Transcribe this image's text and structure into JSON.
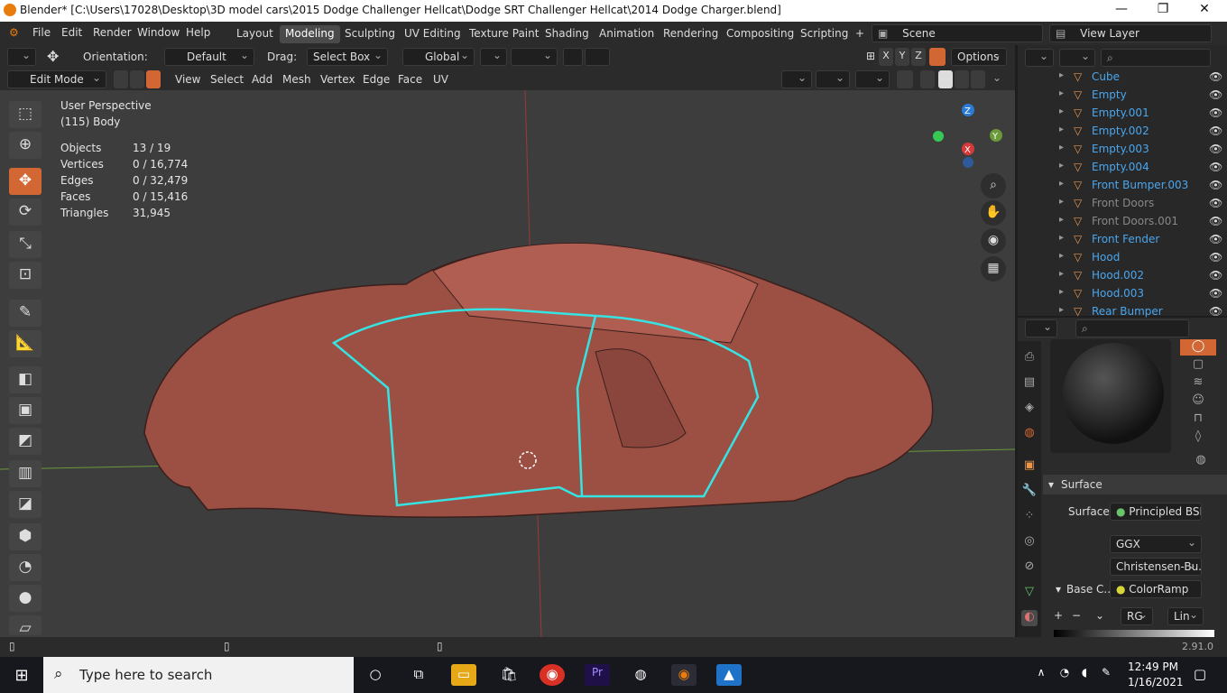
{
  "window": {
    "title": "Blender* [C:\\Users\\17028\\Desktop\\3D model cars\\2015 Dodge Challenger Hellcat\\Dodge SRT Challenger Hellcat\\2014 Dodge Charger.blend]"
  },
  "menus": [
    "File",
    "Edit",
    "Render",
    "Window",
    "Help"
  ],
  "workspaces": [
    "Layout",
    "Modeling",
    "Sculpting",
    "UV Editing",
    "Texture Paint",
    "Shading",
    "Animation",
    "Rendering",
    "Compositing",
    "Scripting"
  ],
  "scene": {
    "name": "Scene",
    "view_layer": "View Layer"
  },
  "header": {
    "orientation_label": "Orientation:",
    "orientation_value": "Default",
    "drag_label": "Drag:",
    "drag_value": "Select Box",
    "transform_value": "Global",
    "axes": [
      "X",
      "Y",
      "Z"
    ],
    "options_label": "Options"
  },
  "mode_bar": {
    "mode": "Edit Mode",
    "menus": [
      "View",
      "Select",
      "Add",
      "Mesh",
      "Vertex",
      "Edge",
      "Face",
      "UV"
    ]
  },
  "viewport": {
    "perspective": "User Perspective",
    "object_label": "(115) Body",
    "stats": [
      {
        "label": "Objects",
        "value": "13 / 19"
      },
      {
        "label": "Vertices",
        "value": "0 / 16,774"
      },
      {
        "label": "Edges",
        "value": "0 / 32,479"
      },
      {
        "label": "Faces",
        "value": "0 / 15,416"
      },
      {
        "label": "Triangles",
        "value": "31,945"
      }
    ],
    "gizmo_axes": [
      "Z",
      "Y",
      "X"
    ]
  },
  "outliner": {
    "items": [
      {
        "name": "Cube",
        "dim": false
      },
      {
        "name": "Empty",
        "dim": false
      },
      {
        "name": "Empty.001",
        "dim": false
      },
      {
        "name": "Empty.002",
        "dim": false
      },
      {
        "name": "Empty.003",
        "dim": false
      },
      {
        "name": "Empty.004",
        "dim": false
      },
      {
        "name": "Front Bumper.003",
        "dim": false
      },
      {
        "name": "Front Doors",
        "dim": true
      },
      {
        "name": "Front Doors.001",
        "dim": true
      },
      {
        "name": "Front Fender",
        "dim": false
      },
      {
        "name": "Hood",
        "dim": false
      },
      {
        "name": "Hood.002",
        "dim": false
      },
      {
        "name": "Hood.003",
        "dim": false
      },
      {
        "name": "Rear Bumper",
        "dim": false
      }
    ]
  },
  "properties": {
    "section": "Surface",
    "surface_label": "Surface",
    "surface_value": "Principled BSDF",
    "distribution": "GGX",
    "subsurface": "Christensen-Bu...",
    "base_color_label": "Base C...",
    "base_color_value": "ColorRamp",
    "ramp_mode": "RG",
    "ramp_interp": "Lin"
  },
  "status": {
    "version": "2.91.0"
  },
  "taskbar": {
    "search_placeholder": "Type here to search",
    "time": "12:49 PM",
    "date": "1/16/2021"
  }
}
